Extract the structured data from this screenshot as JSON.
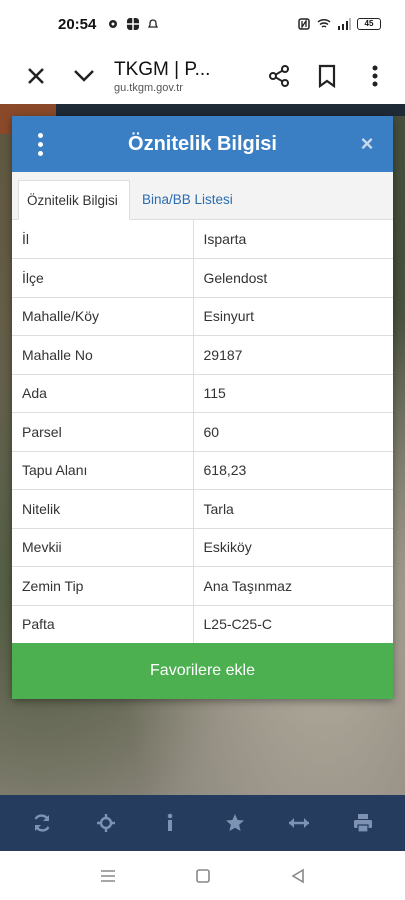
{
  "status": {
    "time": "20:54",
    "battery": "45"
  },
  "browser": {
    "title": "TKGM | P...",
    "url": "gu.tkgm.gov.tr"
  },
  "dialog": {
    "title": "Öznitelik Bilgisi",
    "close_symbol": "×",
    "tabs": [
      {
        "label": "Öznitelik Bilgisi"
      },
      {
        "label": "Bina/BB Listesi"
      }
    ],
    "rows": [
      {
        "key": "İl",
        "value": "Isparta"
      },
      {
        "key": "İlçe",
        "value": "Gelendost"
      },
      {
        "key": "Mahalle/Köy",
        "value": "Esinyurt"
      },
      {
        "key": "Mahalle No",
        "value": "29187"
      },
      {
        "key": "Ada",
        "value": "115"
      },
      {
        "key": "Parsel",
        "value": "60"
      },
      {
        "key": "Tapu Alanı",
        "value": "618,23"
      },
      {
        "key": "Nitelik",
        "value": "Tarla"
      },
      {
        "key": "Mevkii",
        "value": "Eskiköy"
      },
      {
        "key": "Zemin Tip",
        "value": "Ana Taşınmaz"
      },
      {
        "key": "Pafta",
        "value": "L25-C25-C"
      }
    ],
    "favorite_label": "Favorilere ekle"
  },
  "map_toolbar": {
    "icons": [
      "refresh-icon",
      "locate-icon",
      "info-icon",
      "star-icon",
      "measure-icon",
      "print-icon"
    ]
  },
  "colors": {
    "header": "#3a7fc4",
    "favorite": "#4caf50",
    "toolbar": "#263c5e",
    "toolbar_icon": "#7e93b3"
  }
}
